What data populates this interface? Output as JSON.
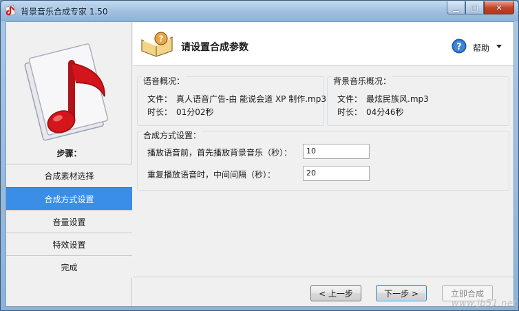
{
  "window": {
    "title": "背景音乐合成专家 1.50"
  },
  "sidebar": {
    "steps_title": "步骤：",
    "items": [
      {
        "label": "合成素材选择",
        "active": false
      },
      {
        "label": "合成方式设置",
        "active": true
      },
      {
        "label": "音量设置",
        "active": false
      },
      {
        "label": "特效设置",
        "active": false
      },
      {
        "label": "完成",
        "active": false
      }
    ]
  },
  "header": {
    "title": "请设置合成参数",
    "help_label": "帮助"
  },
  "voice_overview": {
    "title": "语音概况：",
    "file_key": "文件：",
    "file_value": "真人语音广告-由 能说会道 XP 制作.mp3",
    "duration_key": "时长：",
    "duration_value": "01分02秒"
  },
  "music_overview": {
    "title": "背景音乐概况：",
    "file_key": "文件：",
    "file_value": "最炫民族风.mp3",
    "duration_key": "时长：",
    "duration_value": "04分46秒"
  },
  "mix_settings": {
    "title": "合成方式设置：",
    "pre_play_label": "播放语音前，首先播放背景音乐（秒）：",
    "pre_play_value": "10",
    "interval_label": "重复播放语音时，中间间隔（秒）：",
    "interval_value": "20"
  },
  "footer": {
    "prev_label": "< 上一步",
    "next_label": "下一步 >",
    "finish_label": "立即合成"
  },
  "watermark": "www.jb51.net",
  "colors": {
    "active_step": "#3a8ee6",
    "close_button": "#c5452d"
  }
}
